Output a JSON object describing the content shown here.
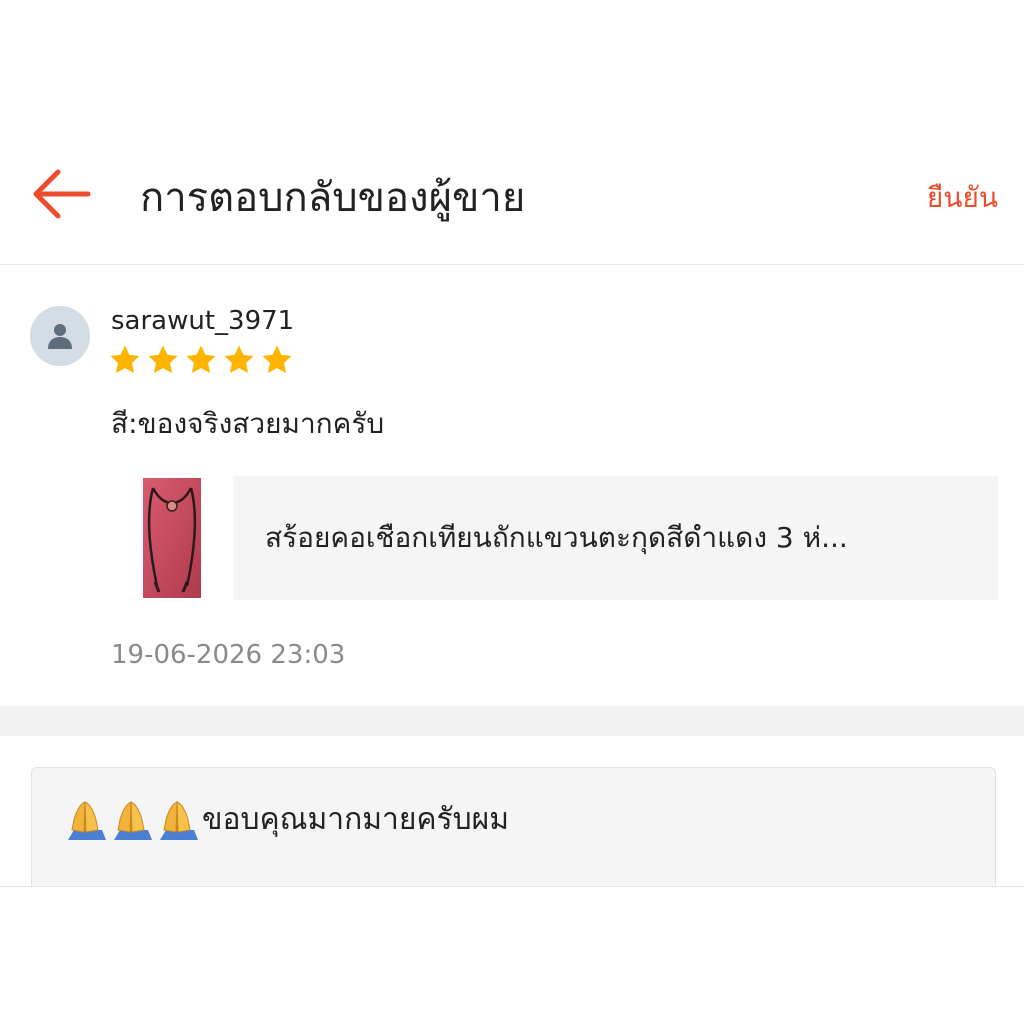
{
  "header": {
    "title": "การตอบกลับของผู้ขาย",
    "confirm_label": "ยืนยัน",
    "back_icon": "arrow-left-icon"
  },
  "review": {
    "username": "sarawut_3971",
    "rating": 5,
    "rating_max": 5,
    "comment": "สี:ของจริงสวยมากครับ",
    "product": {
      "name": "สร้อยคอเชือกเทียนถักแขวนตะกุดสีดำแดง 3 ห่..."
    },
    "timestamp": "19-06-2026 23:03"
  },
  "seller_reply": {
    "text": "ขอบคุณมากมายครับผม",
    "emoji_icons": [
      "folded-hands-icon",
      "folded-hands-icon",
      "folded-hands-icon"
    ]
  },
  "colors": {
    "accent": "#ee4d2d",
    "star": "#ffb400",
    "text": "#222222",
    "muted": "#8a8a8a"
  }
}
